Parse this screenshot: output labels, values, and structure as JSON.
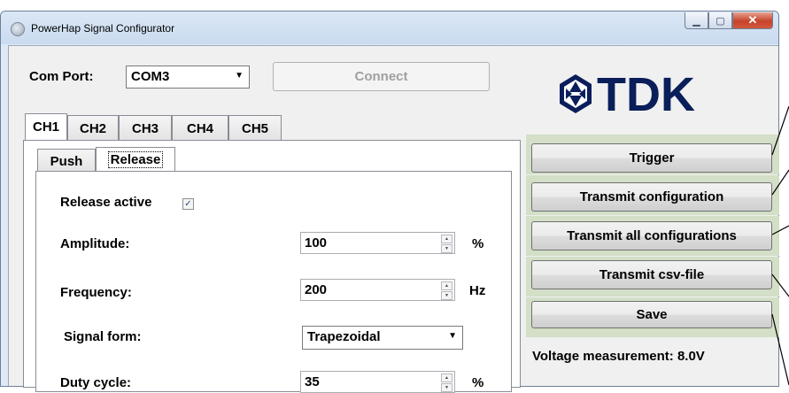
{
  "window": {
    "title": "PowerHap Signal Configurator",
    "minimize_glyph": "▁",
    "maximize_glyph": "▢",
    "close_glyph": "✕"
  },
  "comport": {
    "label": "Com Port:",
    "selected": "COM3",
    "connect_label": "Connect"
  },
  "logo": {
    "text": "TDK",
    "color": "#0a1e5a"
  },
  "channel_tabs": [
    "CH1",
    "CH2",
    "CH3",
    "CH4",
    "CH5"
  ],
  "sub_tabs": [
    "Push",
    "Release"
  ],
  "release": {
    "active_label": "Release active",
    "active_checked": true,
    "amplitude_label": "Amplitude:",
    "amplitude_value": "100",
    "amplitude_unit": "%",
    "frequency_label": "Frequency:",
    "frequency_value": "200",
    "frequency_unit": "Hz",
    "signal_form_label": "Signal form:",
    "signal_form_value": "Trapezoidal",
    "duty_cycle_label": "Duty cycle:",
    "duty_cycle_value": "35",
    "duty_cycle_unit": "%"
  },
  "actions": {
    "trigger": "Trigger",
    "transmit_config": "Transmit configuration",
    "transmit_all": "Transmit all configurations",
    "transmit_csv": "Transmit csv-file",
    "save": "Save"
  },
  "voltage_text": "Voltage measurement: 8.0V",
  "colors": {
    "group_bg": "#d3dfc7",
    "window_frame": "#dfe9f5",
    "client_bg": "#f0f0f0"
  }
}
